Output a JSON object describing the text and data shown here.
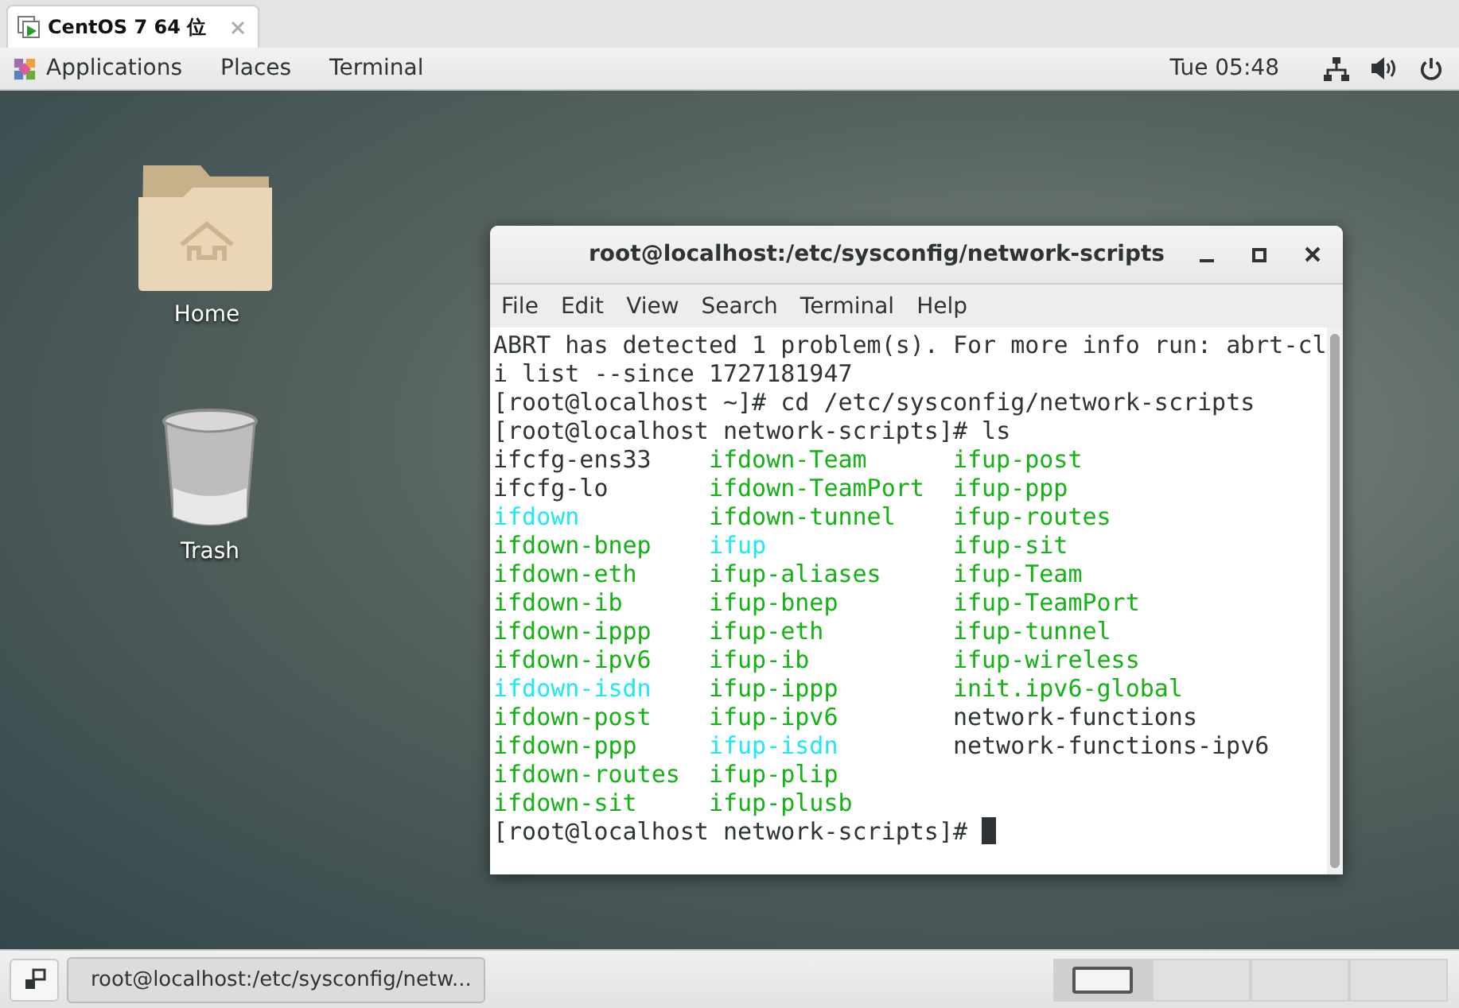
{
  "vm_tab": {
    "title": "CentOS 7 64 位"
  },
  "top_bar": {
    "menus": [
      "Applications",
      "Places",
      "Terminal"
    ],
    "clock": "Tue 05:48"
  },
  "desktop_icons": [
    {
      "label": "Home",
      "kind": "folder"
    },
    {
      "label": "Trash",
      "kind": "trash"
    }
  ],
  "terminal": {
    "title": "root@localhost:/etc/sysconfig/network-scripts",
    "menu": [
      "File",
      "Edit",
      "View",
      "Search",
      "Terminal",
      "Help"
    ],
    "lines_before": [
      "ABRT has detected 1 problem(s). For more info run: abrt-cl",
      "i list --since 1727181947",
      "[root@localhost ~]# cd /etc/sysconfig/network-scripts",
      "[root@localhost network-scripts]# ls"
    ],
    "listing": [
      [
        {
          "name": "ifcfg-ens33",
          "kind": "plain"
        },
        {
          "name": "ifdown-Team",
          "kind": "exec"
        },
        {
          "name": "ifup-post",
          "kind": "exec"
        }
      ],
      [
        {
          "name": "ifcfg-lo",
          "kind": "plain"
        },
        {
          "name": "ifdown-TeamPort",
          "kind": "exec"
        },
        {
          "name": "ifup-ppp",
          "kind": "exec"
        }
      ],
      [
        {
          "name": "ifdown",
          "kind": "link"
        },
        {
          "name": "ifdown-tunnel",
          "kind": "exec"
        },
        {
          "name": "ifup-routes",
          "kind": "exec"
        }
      ],
      [
        {
          "name": "ifdown-bnep",
          "kind": "exec"
        },
        {
          "name": "ifup",
          "kind": "link"
        },
        {
          "name": "ifup-sit",
          "kind": "exec"
        }
      ],
      [
        {
          "name": "ifdown-eth",
          "kind": "exec"
        },
        {
          "name": "ifup-aliases",
          "kind": "exec"
        },
        {
          "name": "ifup-Team",
          "kind": "exec"
        }
      ],
      [
        {
          "name": "ifdown-ib",
          "kind": "exec"
        },
        {
          "name": "ifup-bnep",
          "kind": "exec"
        },
        {
          "name": "ifup-TeamPort",
          "kind": "exec"
        }
      ],
      [
        {
          "name": "ifdown-ippp",
          "kind": "exec"
        },
        {
          "name": "ifup-eth",
          "kind": "exec"
        },
        {
          "name": "ifup-tunnel",
          "kind": "exec"
        }
      ],
      [
        {
          "name": "ifdown-ipv6",
          "kind": "exec"
        },
        {
          "name": "ifup-ib",
          "kind": "exec"
        },
        {
          "name": "ifup-wireless",
          "kind": "exec"
        }
      ],
      [
        {
          "name": "ifdown-isdn",
          "kind": "link"
        },
        {
          "name": "ifup-ippp",
          "kind": "exec"
        },
        {
          "name": "init.ipv6-global",
          "kind": "exec"
        }
      ],
      [
        {
          "name": "ifdown-post",
          "kind": "exec"
        },
        {
          "name": "ifup-ipv6",
          "kind": "exec"
        },
        {
          "name": "network-functions",
          "kind": "plain"
        }
      ],
      [
        {
          "name": "ifdown-ppp",
          "kind": "exec"
        },
        {
          "name": "ifup-isdn",
          "kind": "link"
        },
        {
          "name": "network-functions-ipv6",
          "kind": "plain"
        }
      ],
      [
        {
          "name": "ifdown-routes",
          "kind": "exec"
        },
        {
          "name": "ifup-plip",
          "kind": "exec"
        }
      ],
      [
        {
          "name": "ifdown-sit",
          "kind": "exec"
        },
        {
          "name": "ifup-plusb",
          "kind": "exec"
        }
      ]
    ],
    "prompt": "[root@localhost network-scripts]#"
  },
  "taskbar": {
    "window_button": "root@localhost:/etc/sysconfig/netw...",
    "workspaces": [
      {
        "selected": true
      },
      {
        "selected": false
      },
      {
        "selected": false
      },
      {
        "selected": false
      }
    ]
  }
}
